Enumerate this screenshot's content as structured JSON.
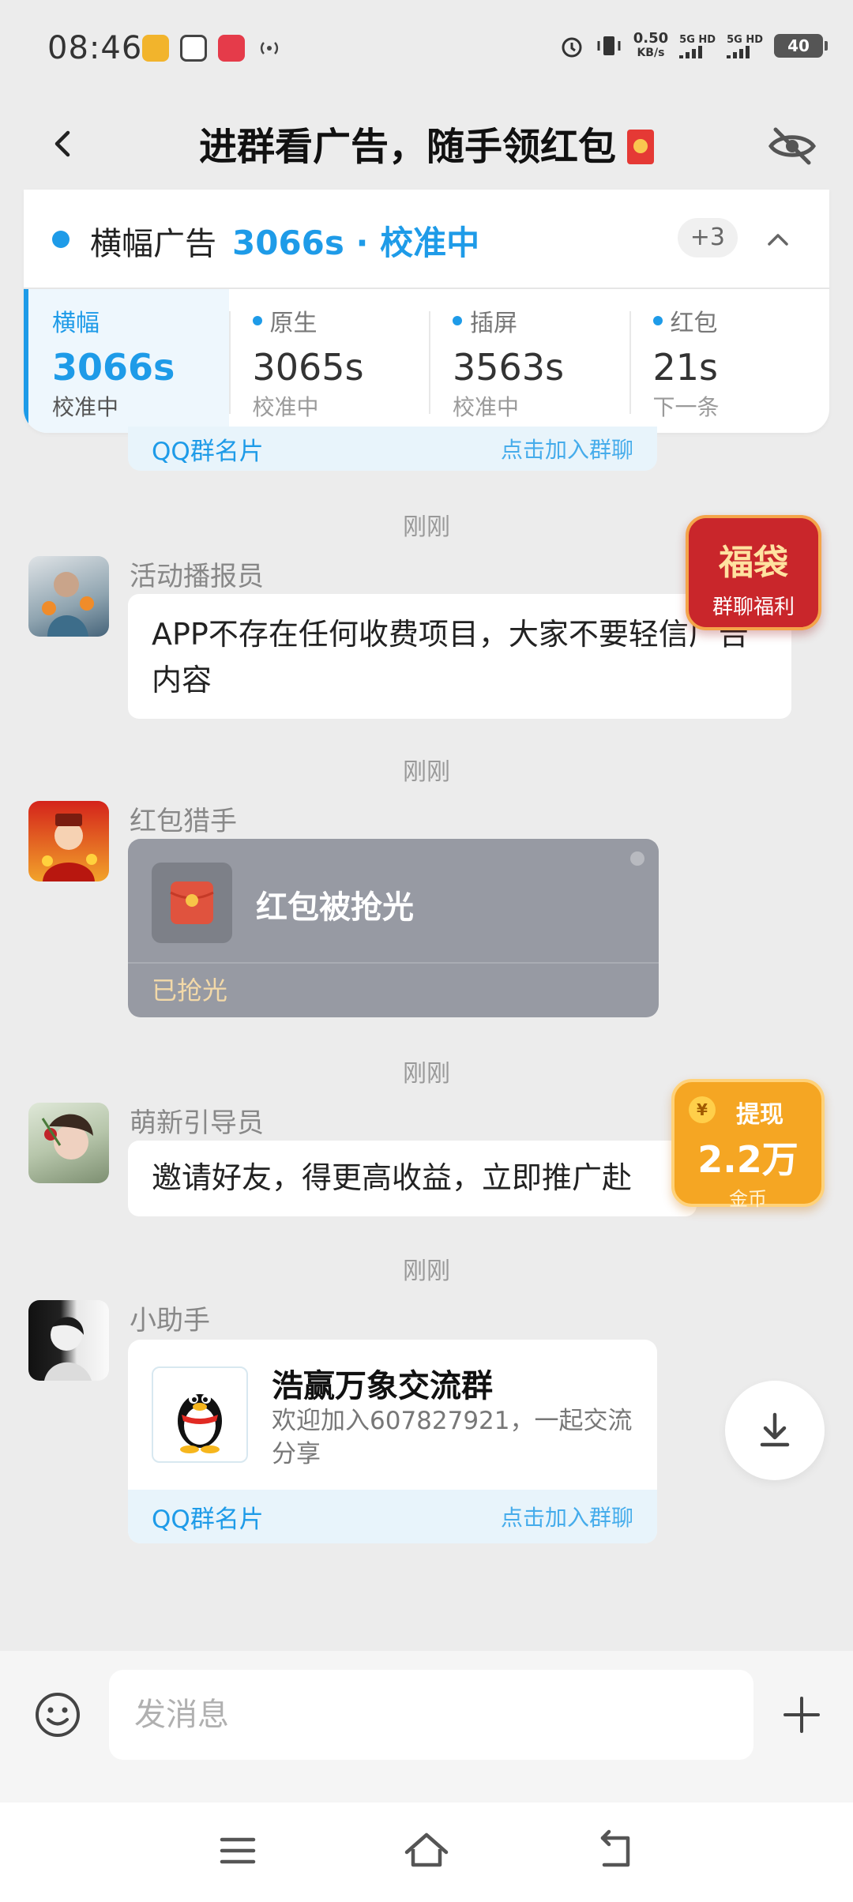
{
  "status_bar": {
    "time": "08:46",
    "net_speed_value": "0.50",
    "net_speed_unit": "KB/s",
    "sim1": "5G HD",
    "sim2": "5G HD",
    "battery": "40"
  },
  "header": {
    "title": "进群看广告，随手领红包",
    "back_icon": "chevron-left-icon",
    "hide_icon": "eye-off-icon"
  },
  "ad_timer": {
    "current_name": "横幅广告",
    "current_status": "3066s · 校准中",
    "more_count": "+3",
    "items": [
      {
        "label": "横幅",
        "value": "3066s",
        "sub": "校准中"
      },
      {
        "label": "原生",
        "value": "3065s",
        "sub": "校准中"
      },
      {
        "label": "插屏",
        "value": "3563s",
        "sub": "校准中"
      },
      {
        "label": "红包",
        "value": "21s",
        "sub": "下一条"
      }
    ]
  },
  "peek_card": {
    "left": "QQ群名片",
    "right": "点击加入群聊"
  },
  "messages": [
    {
      "time": "刚刚",
      "sender": "活动播报员",
      "text": "APP不存在任何收费项目，大家不要轻信广告内容"
    },
    {
      "time": "刚刚",
      "sender": "红包猎手",
      "packet_title": "红包被抢光",
      "packet_status": "已抢光"
    },
    {
      "time": "刚刚",
      "sender": "萌新引导员",
      "text": "邀请好友，得更高收益，立即推广赴"
    },
    {
      "time": "刚刚",
      "sender": "小助手",
      "card_title": "浩赢万象交流群",
      "card_desc": "欢迎加入607827921，一起交流分享",
      "card_footer_left": "QQ群名片",
      "card_footer_right": "点击加入群聊"
    }
  ],
  "floating": {
    "fudai_title": "福袋",
    "fudai_sub": "群聊福利",
    "withdraw_coin": "¥",
    "withdraw_label": "提现",
    "withdraw_amount": "2.2万",
    "withdraw_unit": "金币"
  },
  "input_bar": {
    "placeholder": "发消息"
  },
  "colors": {
    "accent": "#1e9be8",
    "background": "#ececec",
    "packet_grey": "#979aa3"
  }
}
